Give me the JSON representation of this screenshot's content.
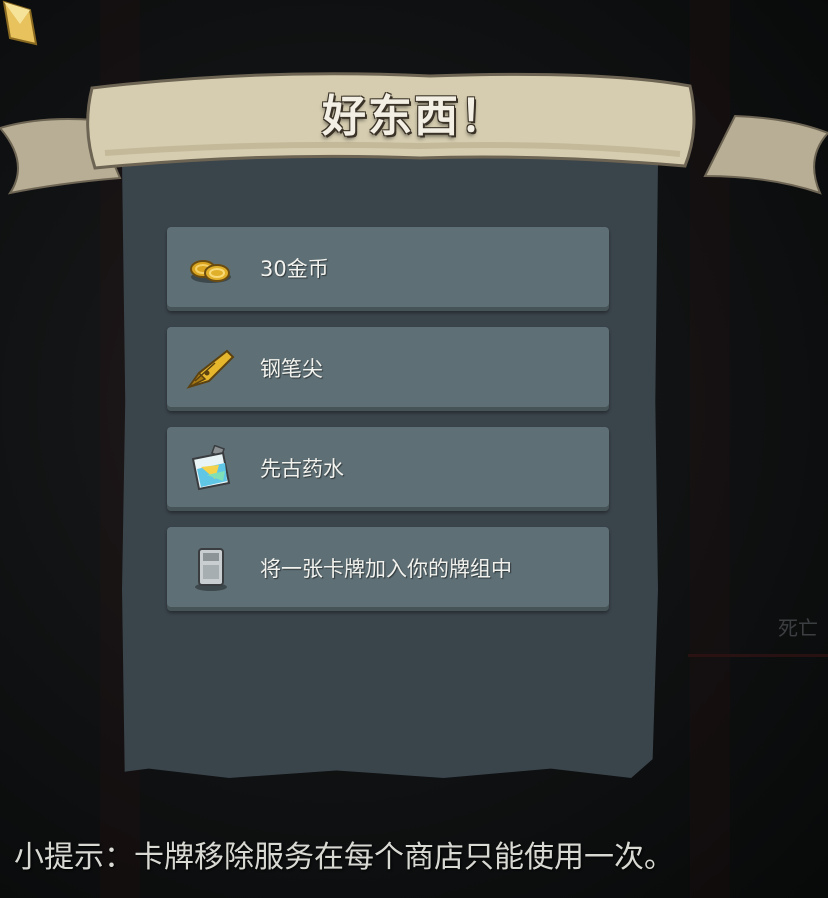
{
  "title": "好东西！",
  "rewards": [
    {
      "label": "30金币",
      "icon": "gold-coins-icon"
    },
    {
      "label": "钢笔尖",
      "icon": "pen-nib-icon"
    },
    {
      "label": "先古药水",
      "icon": "ancient-potion-icon"
    },
    {
      "label": "将一张卡牌加入你的牌组中",
      "icon": "card-icon"
    }
  ],
  "tip": "小提示：卡牌移除服务在每个商店只能使用一次。",
  "background_label": "死亡",
  "colors": {
    "panel": "#3a444b",
    "reward_row": "#5e6f75",
    "banner_parchment": "#d6cdb0",
    "title_text": "#f3efe4"
  }
}
